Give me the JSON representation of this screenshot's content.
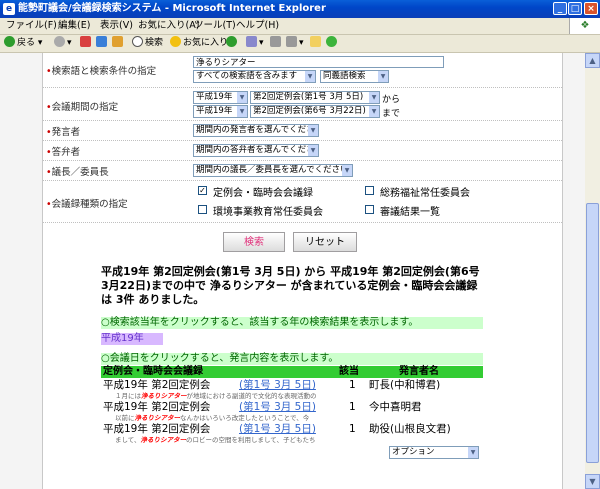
{
  "window": {
    "title": "能勢町議会/会議録検索システム - Microsoft Internet Explorer",
    "controls": {
      "minimize": "_",
      "maximize": "□",
      "close": "×"
    }
  },
  "menu": [
    "ファイル(F)",
    "編集(E)",
    "表示(V)",
    "お気に入り(A)",
    "ツール(T)",
    "ヘルプ(H)"
  ],
  "toolbar": {
    "back": "戻る",
    "search": "検索",
    "favorites": "お気に入り"
  },
  "form": {
    "keyword": {
      "label": "検索語と検索条件の指定",
      "value": "浄るりシアター",
      "scope": "すべての検索語を含みます",
      "synonym": "同義語検索"
    },
    "period": {
      "label": "会議期間の指定",
      "from_year": "平成19年",
      "from_session": "第2回定例会(第1号 3月 5日)",
      "from_suffix": "から",
      "to_year": "平成19年",
      "to_session": "第2回定例会(第6号 3月22日)",
      "to_suffix": "まで"
    },
    "speaker": {
      "label": "発言者",
      "value": "期間内の発言者を選んでください"
    },
    "answerer": {
      "label": "答弁者",
      "value": "期間内の答弁者を選んでください"
    },
    "chair": {
      "label": "議長／委員長",
      "value": "期間内の議長／委員長を選んでください"
    },
    "types": {
      "label": "会議録種類の指定",
      "options": [
        {
          "label": "定例会・臨時会会議録",
          "checked": true
        },
        {
          "label": "総務福祉常任委員会",
          "checked": false
        },
        {
          "label": "環境事業教育常任委員会",
          "checked": false
        },
        {
          "label": "審議結果一覧",
          "checked": false
        }
      ]
    },
    "search_button": "検索",
    "reset_button": "リセット"
  },
  "results": {
    "summary": "平成19年 第2回定例会(第1号 3月 5日)  から  平成19年 第2回定例会(第6号 3月22日)までの中で  浄るりシアター  が含まれている定例会・臨時会会議録  は  3件  ありました。",
    "year_notice": "○検索該当年をクリックすると、該当する年の検索結果を表示します。",
    "year_link": "平成19年",
    "date_notice": "○会議日をクリックすると、発言内容を表示します。",
    "headers": {
      "meeting": "定例会・臨時会会議録",
      "count": "該当",
      "speaker": "発言者名"
    },
    "rows": [
      {
        "meeting": "平成19年 第2回定例会",
        "date": "(第1号 3月 5日)",
        "count": "1",
        "speaker": "町長(中和博君)",
        "snippet_pre": "１月には",
        "snippet_hit": "浄るりシアター",
        "snippet_post": "が地域における副道的で文化的な表現活動の"
      },
      {
        "meeting": "平成19年 第2回定例会",
        "date": "(第1号 3月 5日)",
        "count": "1",
        "speaker": "今中喜明君",
        "snippet_pre": "以前に",
        "snippet_hit": "浄るりシアター",
        "snippet_post": "なんかはいろいろ改定したということで、今"
      },
      {
        "meeting": "平成19年 第2回定例会",
        "date": "(第1号 3月 5日)",
        "count": "1",
        "speaker": "助役(山根良文君)",
        "snippet_pre": "まして、",
        "snippet_hit": "浄るりシアター",
        "snippet_post": "のロビーの空間を利用しまして、子どもたち"
      }
    ],
    "option_select": "オプション"
  },
  "colors": {
    "accent_green": "#33cc33",
    "notice_bg": "#ccffcc",
    "year_bg": "#d8b8ff",
    "link": "#3366cc"
  }
}
